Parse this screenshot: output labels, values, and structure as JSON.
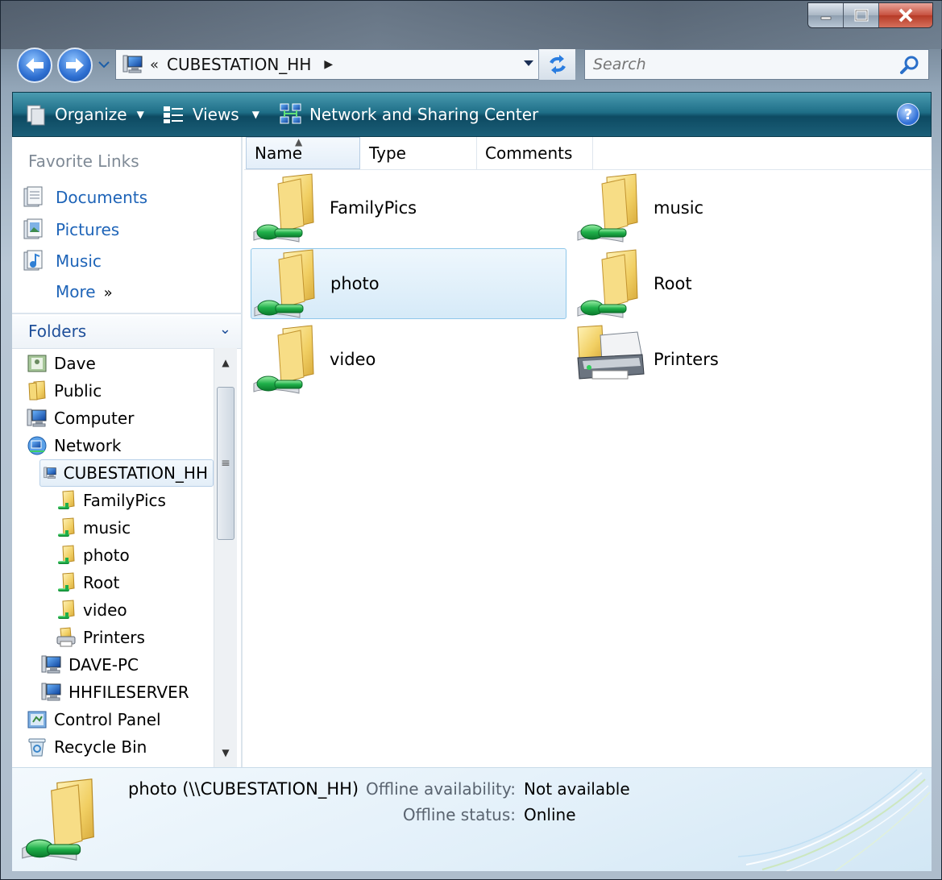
{
  "window": {
    "caption_buttons": [
      "minimize",
      "maximize",
      "close"
    ]
  },
  "address_bar": {
    "overflow": "«",
    "crumb": "CUBESTATION_HH"
  },
  "search": {
    "placeholder": "Search"
  },
  "toolbar": {
    "organize": "Organize",
    "views": "Views",
    "network_center": "Network and Sharing Center",
    "help": "?"
  },
  "favorites": {
    "title": "Favorite Links",
    "items": [
      {
        "label": "Documents",
        "icon": "documents-icon"
      },
      {
        "label": "Pictures",
        "icon": "pictures-icon"
      },
      {
        "label": "Music",
        "icon": "music-icon"
      }
    ],
    "more": "More",
    "more_chevron": "»"
  },
  "folders": {
    "title": "Folders",
    "tree": [
      {
        "label": "Dave",
        "icon": "user-folder-icon"
      },
      {
        "label": "Public",
        "icon": "folder-icon"
      },
      {
        "label": "Computer",
        "icon": "computer-icon"
      },
      {
        "label": "Network",
        "icon": "network-icon"
      },
      {
        "label": "CUBESTATION_HH",
        "icon": "computer-icon"
      },
      {
        "label": "FamilyPics",
        "icon": "share-icon"
      },
      {
        "label": "music",
        "icon": "share-icon"
      },
      {
        "label": "photo",
        "icon": "share-icon"
      },
      {
        "label": "Root",
        "icon": "share-icon"
      },
      {
        "label": "video",
        "icon": "share-icon"
      },
      {
        "label": "Printers",
        "icon": "printers-icon"
      },
      {
        "label": "DAVE-PC",
        "icon": "computer-icon"
      },
      {
        "label": "HHFILESERVER",
        "icon": "computer-icon"
      },
      {
        "label": "Control Panel",
        "icon": "control-panel-icon"
      },
      {
        "label": "Recycle Bin",
        "icon": "recycle-bin-icon"
      }
    ]
  },
  "columns": [
    "Name",
    "Type",
    "Comments"
  ],
  "items": [
    {
      "label": "FamilyPics",
      "icon": "shared-folder-icon"
    },
    {
      "label": "music",
      "icon": "shared-folder-icon"
    },
    {
      "label": "photo",
      "icon": "shared-folder-icon",
      "selected": true
    },
    {
      "label": "Root",
      "icon": "shared-folder-icon"
    },
    {
      "label": "video",
      "icon": "shared-folder-icon"
    },
    {
      "label": "Printers",
      "icon": "printer-icon"
    }
  ],
  "details": {
    "name": "photo (\\\\CUBESTATION_HH)",
    "offline_availability_label": "Offline availability:",
    "offline_availability_value": "Not available",
    "offline_status_label": "Offline status:",
    "offline_status_value": "Online"
  },
  "colors": {
    "link": "#1e64b8",
    "toolbar": "#1f6f88",
    "selection": "#d6eaf8"
  }
}
